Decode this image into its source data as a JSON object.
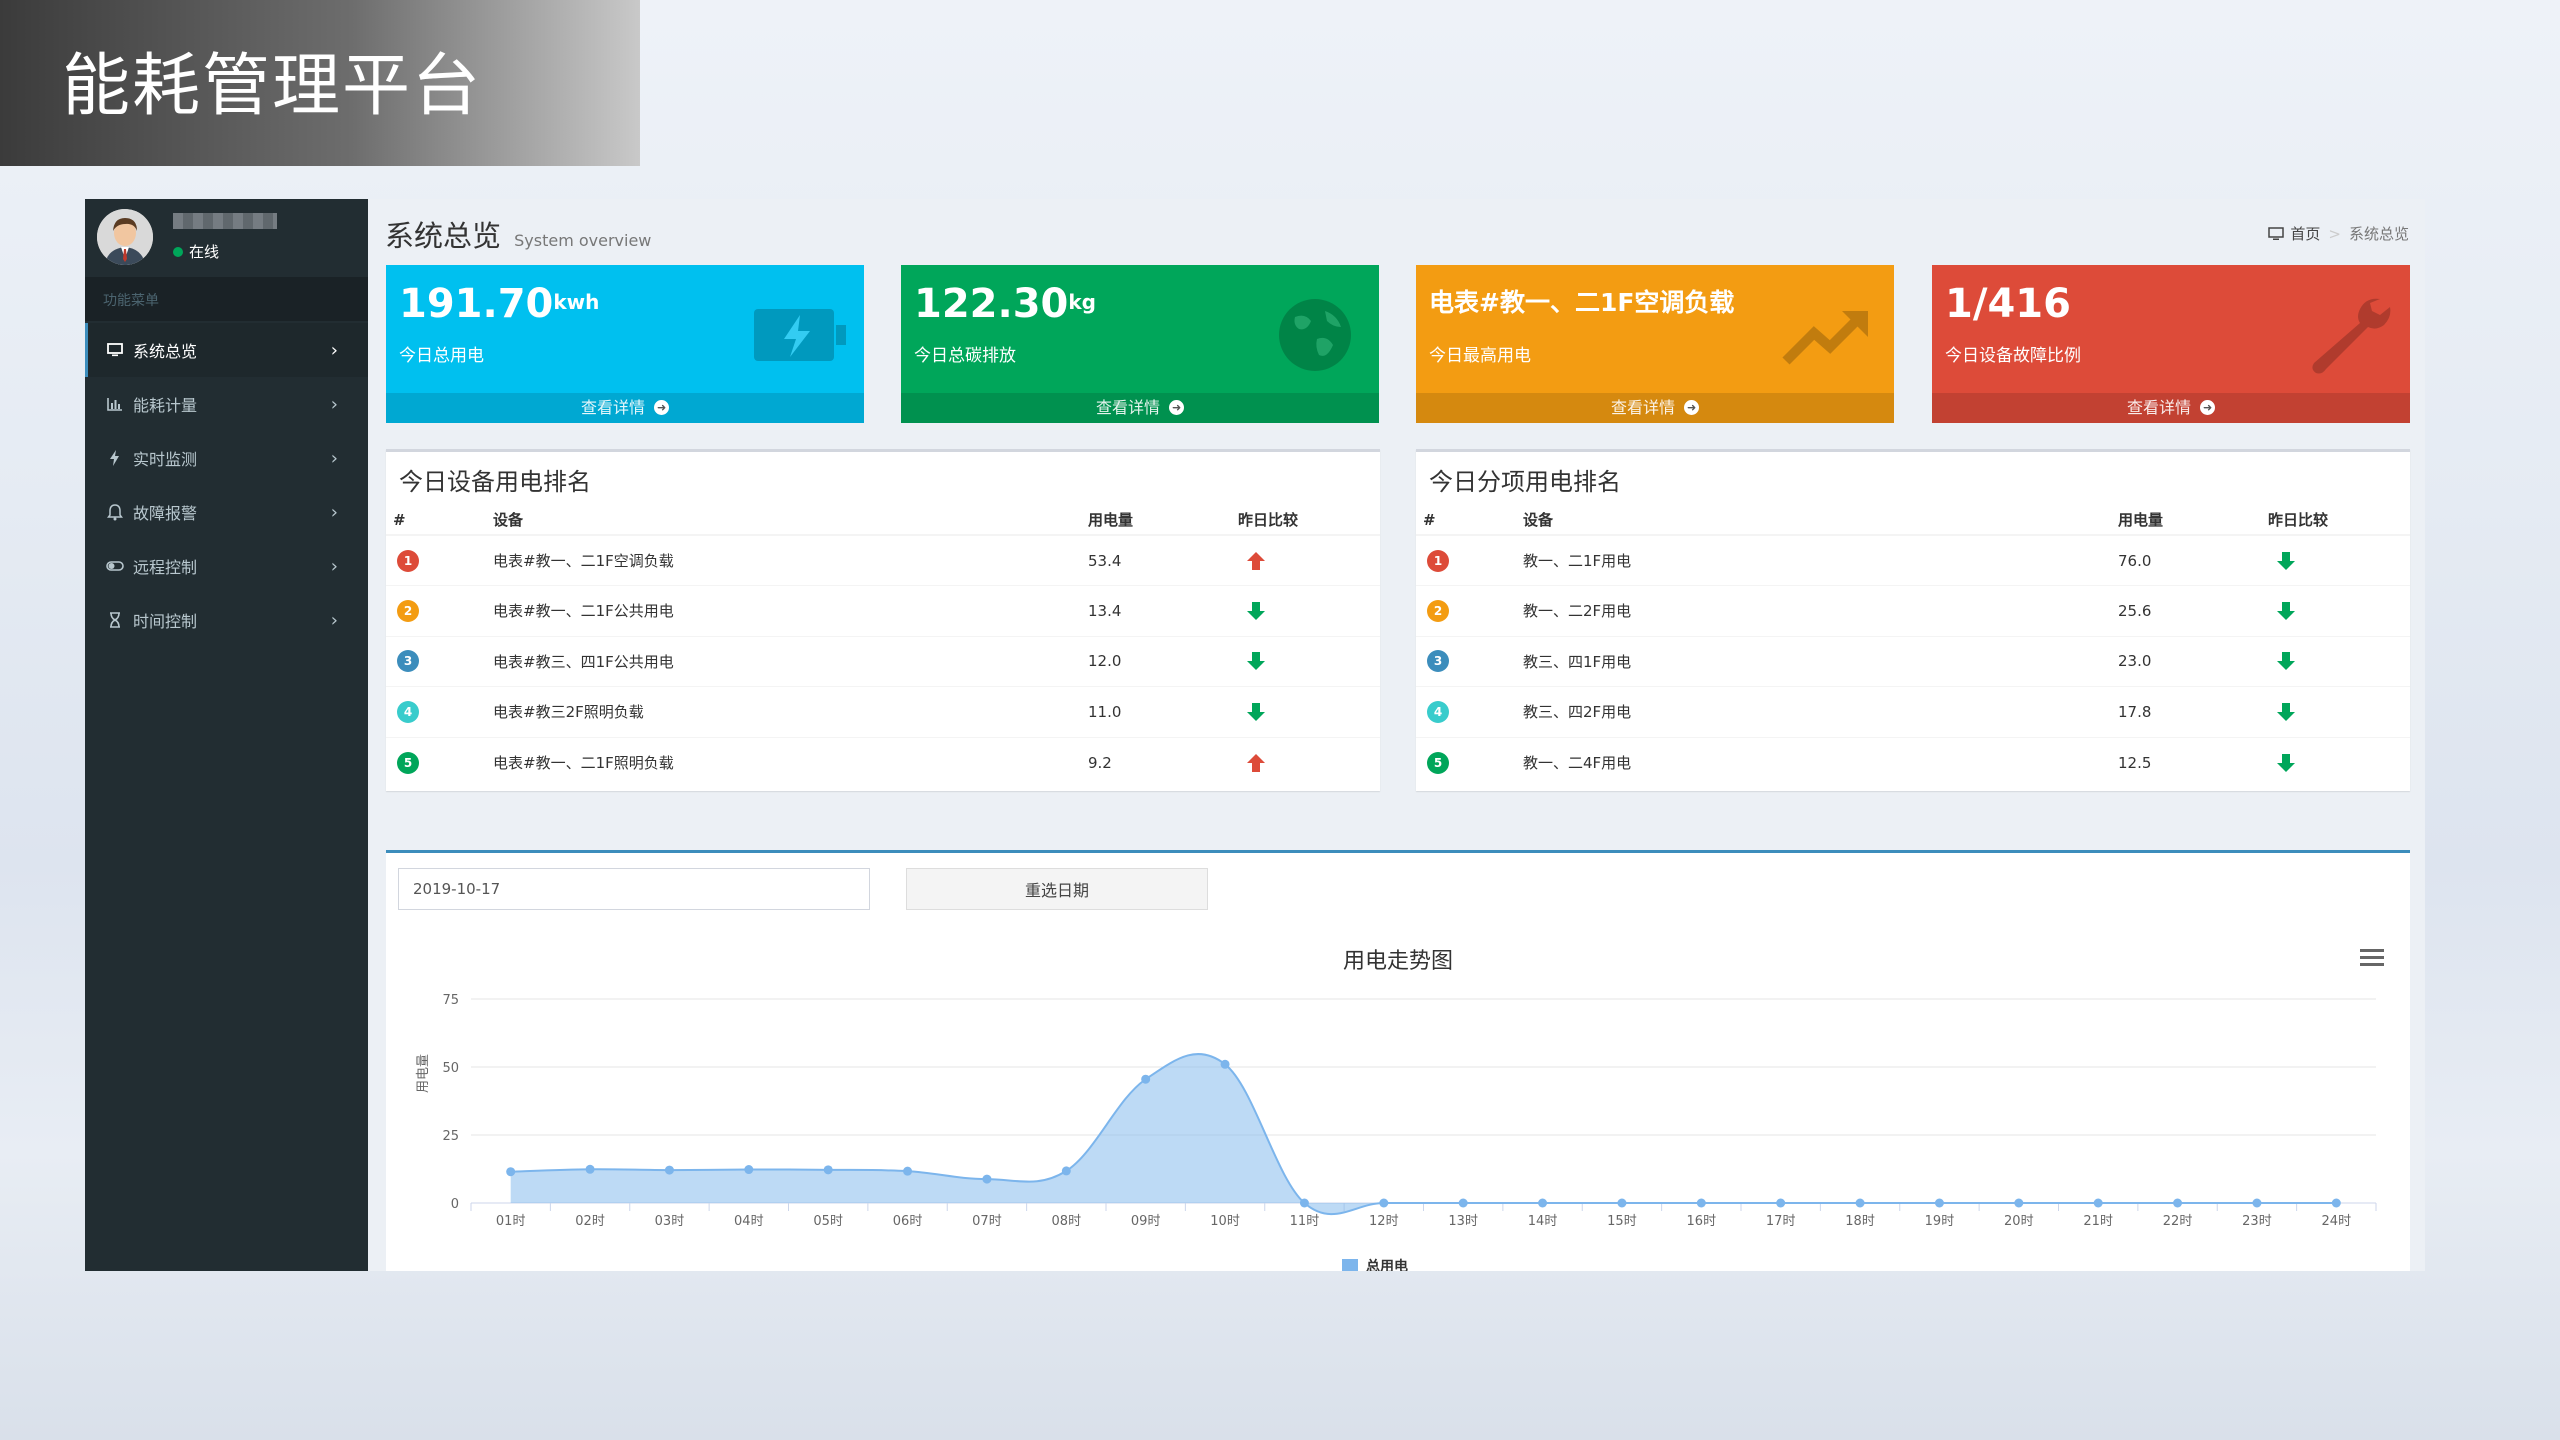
{
  "page": {
    "title": "能耗管理平台"
  },
  "user": {
    "status": "在线"
  },
  "sidebar": {
    "header": "功能菜单",
    "items": [
      {
        "label": "系统总览",
        "icon": "monitor-icon",
        "active": true
      },
      {
        "label": "能耗计量",
        "icon": "bar-chart-icon",
        "active": false
      },
      {
        "label": "实时监测",
        "icon": "bolt-icon",
        "active": false
      },
      {
        "label": "故障报警",
        "icon": "bell-icon",
        "active": false
      },
      {
        "label": "远程控制",
        "icon": "toggle-icon",
        "active": false
      },
      {
        "label": "时间控制",
        "icon": "hourglass-icon",
        "active": false
      }
    ]
  },
  "header": {
    "title": "系统总览",
    "subtitle": "System overview",
    "breadcrumb_home": "首页",
    "breadcrumb_current": "系统总览"
  },
  "boxes": [
    {
      "value": "191.70",
      "unit": "kwh",
      "label": "今日总用电",
      "footer": "查看详情",
      "color": "#00c0ef",
      "icon": "battery-bolt-icon"
    },
    {
      "value": "122.30",
      "unit": "kg",
      "label": "今日总碳排放",
      "footer": "查看详情",
      "color": "#00a65a",
      "icon": "globe-icon"
    },
    {
      "value": "电表#教一、二1F空调负载",
      "unit": "",
      "label": "今日最高用电",
      "footer": "查看详情",
      "color": "#f39c12",
      "icon": "trend-up-icon"
    },
    {
      "value": "1/416",
      "unit": "",
      "label": "今日设备故障比例",
      "footer": "查看详情",
      "color": "#dd4b39",
      "icon": "wrench-icon"
    }
  ],
  "device_ranking": {
    "title": "今日设备用电排名",
    "headers": [
      "#",
      "设备",
      "用电量",
      "昨日比较"
    ],
    "rows": [
      {
        "rank": "1",
        "name": "电表#教一、二1F空调负载",
        "value": "53.4",
        "trend": "up"
      },
      {
        "rank": "2",
        "name": "电表#教一、二1F公共用电",
        "value": "13.4",
        "trend": "down"
      },
      {
        "rank": "3",
        "name": "电表#教三、四1F公共用电",
        "value": "12.0",
        "trend": "down"
      },
      {
        "rank": "4",
        "name": "电表#教三2F照明负载",
        "value": "11.0",
        "trend": "down"
      },
      {
        "rank": "5",
        "name": "电表#教一、二1F照明负载",
        "value": "9.2",
        "trend": "up"
      }
    ]
  },
  "item_ranking": {
    "title": "今日分项用电排名",
    "headers": [
      "#",
      "设备",
      "用电量",
      "昨日比较"
    ],
    "rows": [
      {
        "rank": "1",
        "name": "教一、二1F用电",
        "value": "76.0",
        "trend": "down"
      },
      {
        "rank": "2",
        "name": "教一、二2F用电",
        "value": "25.6",
        "trend": "down"
      },
      {
        "rank": "3",
        "name": "教三、四1F用电",
        "value": "23.0",
        "trend": "down"
      },
      {
        "rank": "4",
        "name": "教三、四2F用电",
        "value": "17.8",
        "trend": "down"
      },
      {
        "rank": "5",
        "name": "教一、二4F用电",
        "value": "12.5",
        "trend": "down"
      }
    ]
  },
  "date_filter": {
    "value": "2019-10-17",
    "button": "重选日期"
  },
  "colors": {
    "up": "#dd4b39",
    "down": "#00a65a",
    "series": "#7cb5ec"
  },
  "chart_data": {
    "type": "area",
    "title": "用电走势图",
    "ylabel": "用电量",
    "xlabel": "",
    "x": [
      "01时",
      "02时",
      "03时",
      "04时",
      "05时",
      "06时",
      "07时",
      "08时",
      "09时",
      "10时",
      "11时",
      "12时",
      "13时",
      "14时",
      "15时",
      "16时",
      "17时",
      "18时",
      "19时",
      "20时",
      "21时",
      "22时",
      "23时",
      "24时"
    ],
    "ylim": [
      0,
      75
    ],
    "yticks": [
      0,
      25,
      50,
      75
    ],
    "grid": true,
    "legend": "bottom",
    "series": [
      {
        "name": "总用电",
        "values": [
          11.5,
          12.4,
          12.1,
          12.3,
          12.2,
          11.7,
          8.8,
          11.8,
          45.5,
          51.0,
          0,
          0,
          0,
          0,
          0,
          0,
          0,
          0,
          0,
          0,
          0,
          0,
          0,
          0
        ]
      }
    ]
  }
}
